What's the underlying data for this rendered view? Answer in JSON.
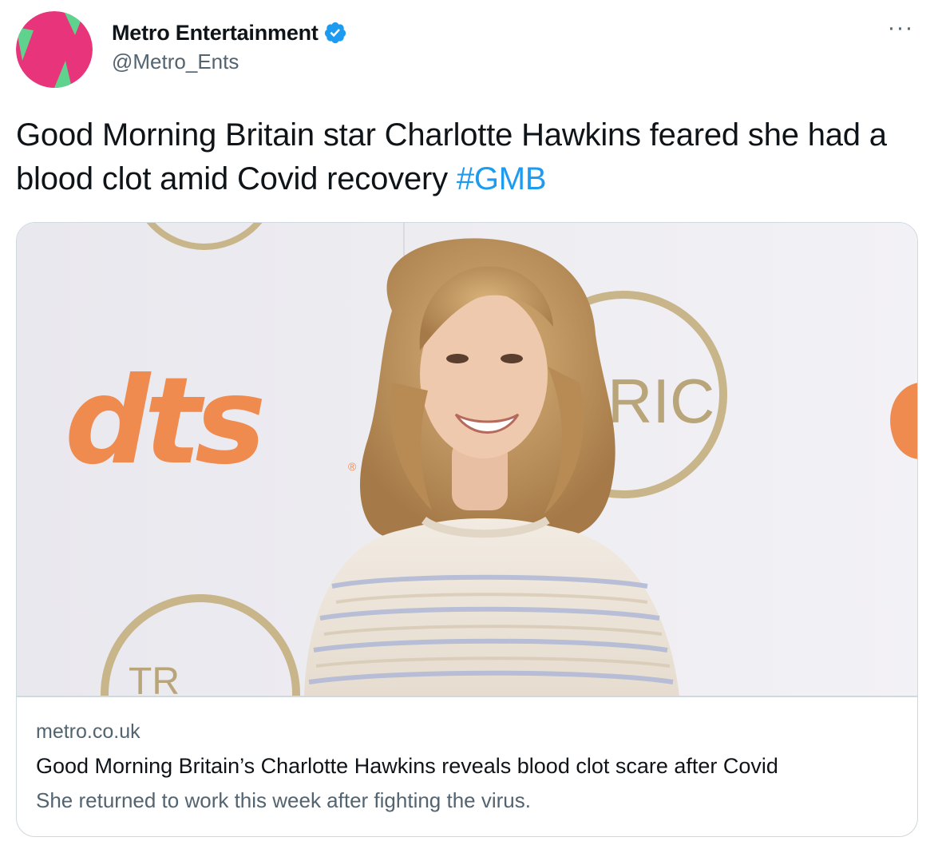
{
  "author": {
    "display_name": "Metro Entertainment",
    "handle": "@Metro_Ents",
    "verified": true,
    "avatar_icon": "metro-m-logo",
    "avatar_colors": {
      "background": "#e8347a",
      "accent": "#5fd38d"
    }
  },
  "menu": {
    "more_icon": "more-horizontal-icon",
    "more_label": "···"
  },
  "tweet": {
    "text": "Good Morning Britain star Charlotte Hawkins feared she had a blood clot amid Covid recovery ",
    "hashtag": "#GMB"
  },
  "card": {
    "image_alt": "Charlotte Hawkins at a press wall",
    "domain": "metro.co.uk",
    "title": "Good Morning Britain’s Charlotte Hawkins reveals blood clot scare after Covid",
    "description": "She returned to work this week after fighting the virus.",
    "backdrop_text": {
      "logo": "dts",
      "ring_text": "RIC",
      "ring_text_lower": "TR",
      "registered_mark": "®"
    }
  },
  "colors": {
    "link": "#1d9bf0",
    "text_primary": "#0f1419",
    "text_secondary": "#536471",
    "border": "#cfd9de",
    "verified": "#1d9bf0",
    "dts_orange": "#ef8b4f",
    "gold_ring": "#c8b58a"
  }
}
